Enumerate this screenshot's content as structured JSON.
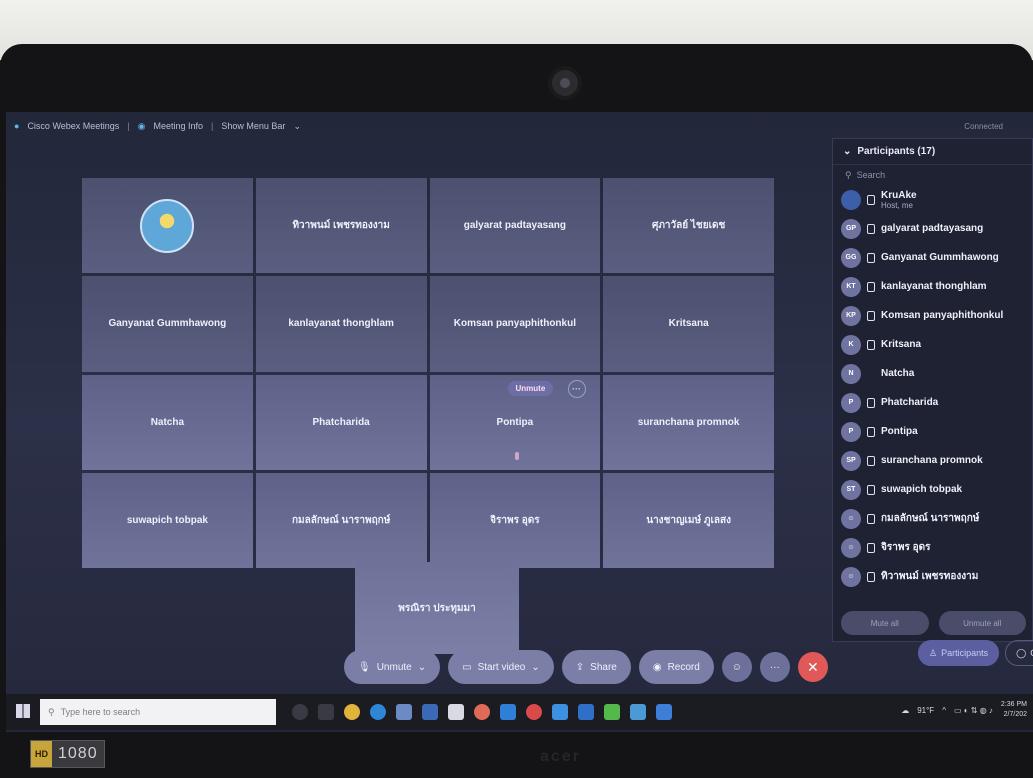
{
  "app": {
    "title": "Cisco Webex Meetings",
    "meeting_info": "Meeting Info",
    "menu_bar": "Show Menu Bar",
    "status": "Connected"
  },
  "grid": {
    "tiles": [
      {
        "label": "",
        "logo": true
      },
      {
        "label": "ทิวาพนม์ เพชรทองงาม"
      },
      {
        "label": "galyarat padtayasang"
      },
      {
        "label": "ศุภาวัลย์ ไชยเดช"
      },
      {
        "label": "Ganyanat Gummhawong"
      },
      {
        "label": "kanlayanat thonghlam"
      },
      {
        "label": "Komsan panyaphithonkul"
      },
      {
        "label": "Kritsana"
      },
      {
        "label": "Natcha"
      },
      {
        "label": "Phatcharida"
      },
      {
        "label": "Pontipa",
        "unmute_chip": "Unmute",
        "more": "···"
      },
      {
        "label": "suranchana promnok"
      },
      {
        "label": "suwapich tobpak"
      },
      {
        "label": "กมลลักษณ์ นาราพฤกษ์"
      },
      {
        "label": "จิราพร อุดร"
      },
      {
        "label": "นางชาญเมษ์ ภูเลสง"
      }
    ],
    "solo_label": "พรณิรา ประทุมมา"
  },
  "participants": {
    "title": "Participants (17)",
    "search_placeholder": "Search",
    "items": [
      {
        "name": "KruAke",
        "sub": "Host, me",
        "initials": "",
        "host": true
      },
      {
        "name": "galyarat padtayasang",
        "initials": "GP"
      },
      {
        "name": "Ganyanat Gummhawong",
        "initials": "GG"
      },
      {
        "name": "kanlayanat thonghlam",
        "initials": "KT"
      },
      {
        "name": "Komsan panyaphithonkul",
        "initials": "KP"
      },
      {
        "name": "Kritsana",
        "initials": "K"
      },
      {
        "name": "Natcha",
        "initials": "N"
      },
      {
        "name": "Phatcharida",
        "initials": "P"
      },
      {
        "name": "Pontipa",
        "initials": "P"
      },
      {
        "name": "suranchana promnok",
        "initials": "SP"
      },
      {
        "name": "suwapich tobpak",
        "initials": "ST"
      },
      {
        "name": "กมลลักษณ์ นาราพฤกษ์",
        "initials": ""
      },
      {
        "name": "จิราพร อุดร",
        "initials": ""
      },
      {
        "name": "ทิวาพนม์ เพชรทองงาม",
        "initials": ""
      }
    ],
    "mute_all": "Mute all",
    "unmute_all": "Unmute all"
  },
  "tabs": {
    "participants": "Participants",
    "chat": "Ch"
  },
  "controls": {
    "unmute": "Unmute",
    "start_video": "Start video",
    "share": "Share",
    "record": "Record"
  },
  "taskbar": {
    "search_placeholder": "Type here to search",
    "temp": "91°F",
    "time": "2:36 PM",
    "date": "2/7/202"
  },
  "overlay": {
    "hd": "HD",
    "resolution": "1080"
  },
  "brand": "acer",
  "colors": {
    "accent": "#5b5fa0",
    "end_call": "#e05858",
    "tile": "#5a5e80"
  }
}
